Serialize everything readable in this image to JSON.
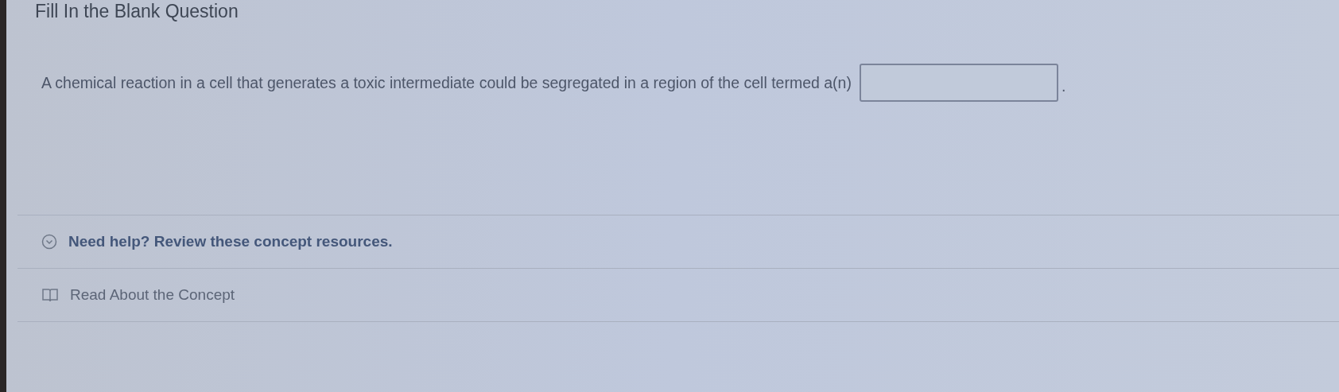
{
  "title": "Fill In the Blank Question",
  "question": {
    "text_before": "A chemical reaction in a cell that generates a toxic intermediate could be segregated in a region of the cell termed a(n)",
    "text_after": "."
  },
  "help": {
    "label": "Need help? Review these concept resources."
  },
  "resources": [
    {
      "label": "Read About the Concept"
    }
  ]
}
